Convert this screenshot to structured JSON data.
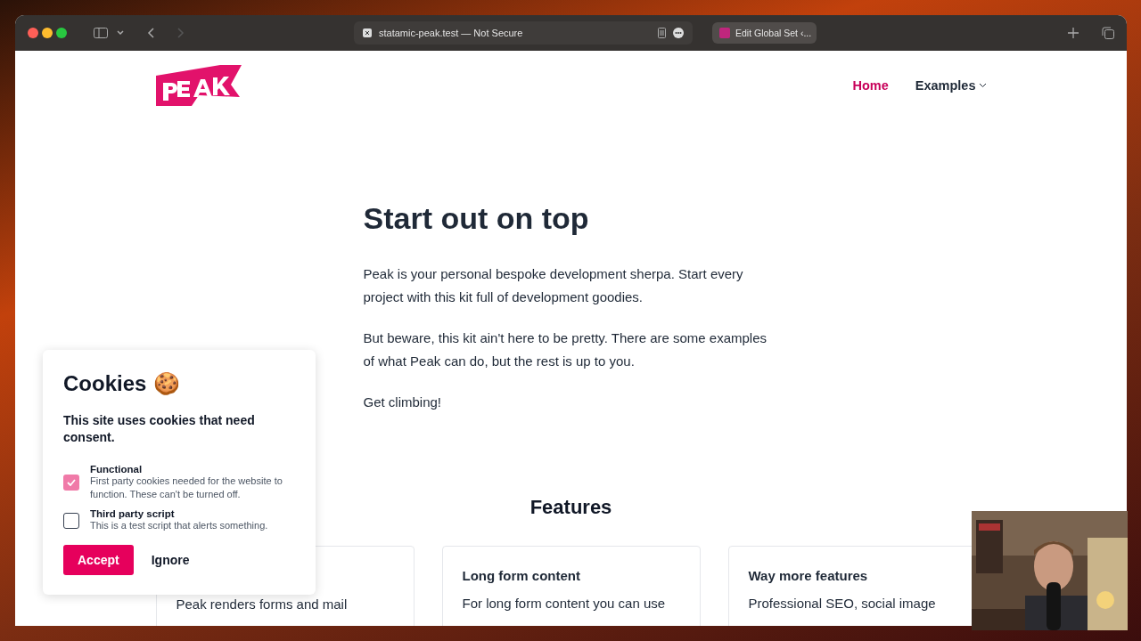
{
  "browser": {
    "address": "statamic-peak.test — Not Secure",
    "tabs": [
      {
        "label": "Edit Global Set ‹...",
        "selected": false
      }
    ]
  },
  "nav": {
    "items": [
      {
        "label": "Home",
        "selected": true
      },
      {
        "label": "Examples",
        "selected": false,
        "dropdown": true
      }
    ]
  },
  "hero": {
    "title": "Start out on top",
    "paragraphs": [
      "Peak is your personal bespoke development sherpa. Start every project with this kit full of development goodies.",
      "But beware, this kit ain't here to be pretty. There are some examples of what Peak can do, but the rest is up to you.",
      "Get climbing!"
    ]
  },
  "features": {
    "title": "Features",
    "cards": [
      {
        "text": "Peak renders forms and mail"
      },
      {
        "title": "Long form content",
        "text": "For long form content you can use"
      },
      {
        "title": "Way more features",
        "text": "Professional SEO, social image"
      }
    ]
  },
  "cookies": {
    "title": "Cookies",
    "emoji": "🍪",
    "intro": "This site uses cookies that need consent.",
    "options": [
      {
        "label": "Functional",
        "description": "First party cookies needed for the website to function. These can't be turned off.",
        "checked": true,
        "disabled": true
      },
      {
        "label": "Third party script",
        "description": "This is a test script that alerts something.",
        "checked": false,
        "disabled": false
      }
    ],
    "accept": "Accept",
    "ignore": "Ignore"
  }
}
